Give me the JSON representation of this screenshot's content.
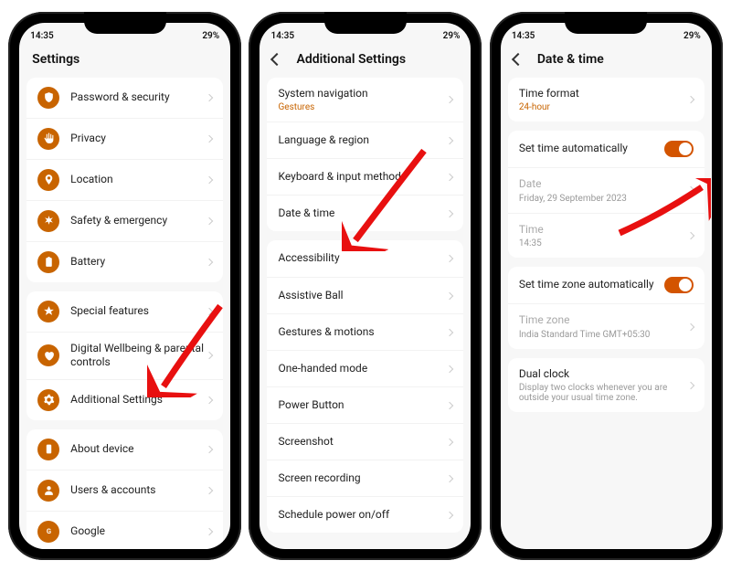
{
  "status": {
    "time": "14:35",
    "battery": "29%"
  },
  "phone1": {
    "title": "Settings",
    "group1": [
      {
        "icon": "shield",
        "label": "Password & security"
      },
      {
        "icon": "hand",
        "label": "Privacy"
      },
      {
        "icon": "pin",
        "label": "Location"
      },
      {
        "icon": "asterisk",
        "label": "Safety & emergency"
      },
      {
        "icon": "battery",
        "label": "Battery"
      }
    ],
    "group2": [
      {
        "icon": "star",
        "label": "Special features"
      },
      {
        "icon": "heart",
        "label": "Digital Wellbeing & parental controls"
      },
      {
        "icon": "gear",
        "label": "Additional Settings"
      }
    ],
    "group3": [
      {
        "icon": "info",
        "label": "About device"
      },
      {
        "icon": "user",
        "label": "Users & accounts"
      },
      {
        "icon": "g",
        "label": "Google"
      }
    ]
  },
  "phone2": {
    "title": "Additional Settings",
    "group1": [
      {
        "label": "System navigation",
        "sub": "Gestures"
      },
      {
        "label": "Language & region"
      },
      {
        "label": "Keyboard & input method"
      },
      {
        "label": "Date & time"
      }
    ],
    "group2": [
      {
        "label": "Accessibility"
      },
      {
        "label": "Assistive Ball"
      },
      {
        "label": "Gestures & motions"
      },
      {
        "label": "One-handed mode"
      },
      {
        "label": "Power Button"
      },
      {
        "label": "Screenshot"
      },
      {
        "label": "Screen recording"
      },
      {
        "label": "Schedule power on/off"
      }
    ]
  },
  "phone3": {
    "title": "Date & time",
    "time_format": {
      "label": "Time format",
      "value": "24-hour"
    },
    "auto_time": {
      "label": "Set time automatically"
    },
    "date": {
      "label": "Date",
      "value": "Friday, 29 September 2023"
    },
    "time": {
      "label": "Time",
      "value": "14:35"
    },
    "auto_tz": {
      "label": "Set time zone automatically"
    },
    "tz": {
      "label": "Time zone",
      "value": "India Standard Time GMT+05:30"
    },
    "dual": {
      "label": "Dual clock",
      "desc": "Display two clocks whenever you are outside your usual time zone."
    }
  }
}
